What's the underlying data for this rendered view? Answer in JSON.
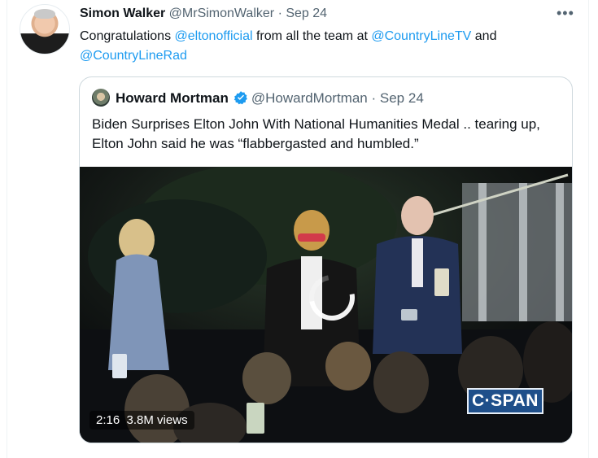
{
  "tweet": {
    "display_name": "Simon Walker",
    "handle": "@MrSimonWalker",
    "separator": "·",
    "date": "Sep 24",
    "more_icon": "more-horizontal-icon",
    "text_parts": {
      "p1": "Congratulations ",
      "mention1": "@eltonofficial",
      "p2": " from all the team at ",
      "mention2": "@CountryLineTV",
      "p3": " and",
      "mention3": "@CountryLineRad"
    }
  },
  "quote": {
    "display_name": "Howard Mortman",
    "verified_icon": "verified-badge-icon",
    "handle": "@HowardMortman",
    "separator": "·",
    "date": "Sep 24",
    "text": "Biden Surprises Elton John With National Humanities Medal .. tearing up, Elton John said he was “flabbergasted and humbled.”",
    "video": {
      "duration": "2:16",
      "views": "3.8M views",
      "channel_logo_text": "C·SPAN",
      "loading_icon": "loading-spinner-icon"
    }
  },
  "colors": {
    "link": "#1d9bf0",
    "muted": "#536471",
    "verified": "#1d9bf0",
    "border": "#cfd9de"
  }
}
